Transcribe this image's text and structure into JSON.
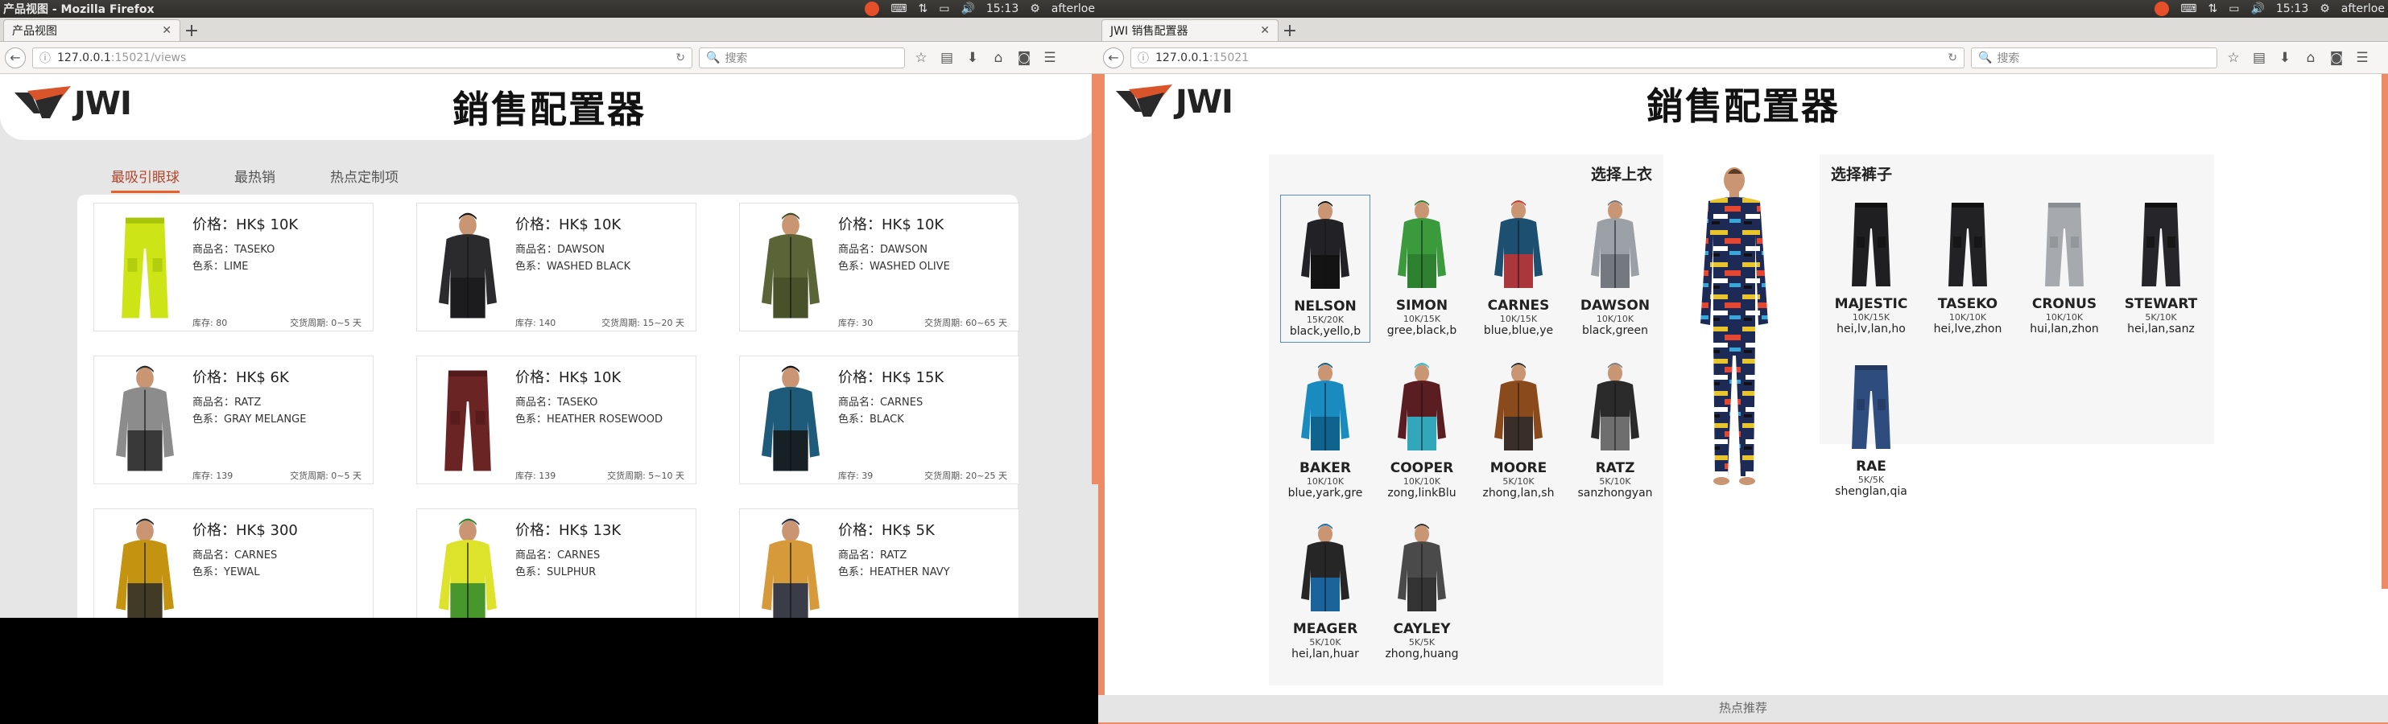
{
  "left": {
    "window_title": "产品视图 - Mozilla Firefox",
    "tab_title": "产品视图",
    "url_host": "127.0.0.1",
    "url_rest": ":15021/views",
    "search_placeholder": "搜索",
    "indicators": {
      "time": "15:13",
      "user": "afterloe"
    },
    "logo": "JWI",
    "title": "銷售配置器",
    "tabs": [
      "最吸引眼球",
      "最热销",
      "热点定制项"
    ],
    "cards": [
      {
        "price": "价格：HK$ 10K",
        "name": "商品名：TASEKO",
        "color": "色系：LIME",
        "stock": "库存: 80",
        "lead": "交货周期: 0~5 天",
        "img": "pants",
        "c1": "#cde516",
        "c2": "#a8c40b"
      },
      {
        "price": "价格：HK$ 10K",
        "name": "商品名：DAWSON",
        "color": "色系：WASHED BLACK",
        "stock": "库存: 140",
        "lead": "交货周期: 15~20 天",
        "img": "jacket",
        "c1": "#2b2b2e",
        "c2": "#1a1a1c"
      },
      {
        "price": "价格：HK$ 10K",
        "name": "商品名：DAWSON",
        "color": "色系：WASHED OLIVE",
        "stock": "库存: 30",
        "lead": "交货周期: 60~65 天",
        "img": "jacket",
        "c1": "#5a6436",
        "c2": "#454d28"
      },
      {
        "price": "价格：HK$ 6K",
        "name": "商品名：RATZ",
        "color": "色系：GRAY MELANGE",
        "stock": "库存: 139",
        "lead": "交货周期: 0~5 天",
        "img": "jacket",
        "c1": "#8c8c8c",
        "c2": "#2a2a2a"
      },
      {
        "price": "价格：HK$ 10K",
        "name": "商品名：TASEKO",
        "color": "色系：HEATHER ROSEWOOD",
        "stock": "库存: 139",
        "lead": "交货周期: 5~10 天",
        "img": "pants",
        "c1": "#6a2424",
        "c2": "#521a1a"
      },
      {
        "price": "价格：HK$ 15K",
        "name": "商品名：CARNES",
        "color": "色系：BLACK",
        "stock": "库存: 39",
        "lead": "交货周期: 20~25 天",
        "img": "jacket",
        "c1": "#1e5b7a",
        "c2": "#161616"
      },
      {
        "price": "价格：HK$ 300",
        "name": "商品名：CARNES",
        "color": "色系：YEWAL",
        "stock": "",
        "lead": "",
        "img": "jacket",
        "c1": "#c4930f",
        "c2": "#2a2a2a"
      },
      {
        "price": "价格：HK$ 13K",
        "name": "商品名：CARNES",
        "color": "色系：SULPHUR",
        "stock": "",
        "lead": "",
        "img": "jacket",
        "c1": "#dde22a",
        "c2": "#2d8a2e"
      },
      {
        "price": "价格：HK$ 5K",
        "name": "商品名：RATZ",
        "color": "色系：HEATHER NAVY",
        "stock": "",
        "lead": "",
        "img": "jacket",
        "c1": "#d69a3a",
        "c2": "#1f2b4a"
      }
    ]
  },
  "right": {
    "window_title": "",
    "tab_title": "JWI 销售配置器",
    "url_host": "127.0.0.1",
    "url_rest": ":15021",
    "search_placeholder": "搜索",
    "indicators": {
      "time": "15:13",
      "user": "afterloe"
    },
    "logo": "JWI",
    "title": "銷售配置器",
    "top_label": "选择上衣",
    "bottom_label": "选择裤子",
    "footer": "热点推荐",
    "tops": [
      {
        "name": "NELSON",
        "price": "15K/20K",
        "color": "black,yello,b",
        "c1": "#222226",
        "c2": "#111"
      },
      {
        "name": "SIMON",
        "price": "10K/15K",
        "color": "gree,black,b",
        "c1": "#3a9a3c",
        "c2": "#2c7d2e"
      },
      {
        "name": "CARNES",
        "price": "10K/15K",
        "color": "blue,blue,ye",
        "c1": "#1c4f70",
        "c2": "#c43232"
      },
      {
        "name": "DAWSON",
        "price": "10K/10K",
        "color": "black,green",
        "c1": "#9aa0a6",
        "c2": "#6d7278"
      },
      {
        "name": "BAKER",
        "price": "10K/10K",
        "color": "blue,yark,gre",
        "c1": "#1a8bbf",
        "c2": "#0d5d86"
      },
      {
        "name": "COOPER",
        "price": "10K/10K",
        "color": "zong,linkBlu",
        "c1": "#5a1d22",
        "c2": "#2cc0d6"
      },
      {
        "name": "MOORE",
        "price": "5K/10K",
        "color": "zhong,lan,sh",
        "c1": "#8a4a1c",
        "c2": "#2a2a2a"
      },
      {
        "name": "RATZ",
        "price": "5K/10K",
        "color": "sanzhongyan",
        "c1": "#2a2a2a",
        "c2": "#7a7a7a"
      },
      {
        "name": "MEAGER",
        "price": "5K/10K",
        "color": "hei,lan,huar",
        "c1": "#262626",
        "c2": "#1a6fb0"
      },
      {
        "name": "CAYLEY",
        "price": "5K/5K",
        "color": "zhong,huang",
        "c1": "#4a4a4a",
        "c2": "#2f2f2f"
      }
    ],
    "bottoms": [
      {
        "name": "MAJESTIC",
        "price": "10K/15K",
        "color": "hei,lv,lan,ho",
        "c1": "#1f1f22",
        "c2": "#111"
      },
      {
        "name": "TASEKO",
        "price": "10K/10K",
        "color": "hei,lve,zhon",
        "c1": "#222225",
        "c2": "#111"
      },
      {
        "name": "CRONUS",
        "price": "10K/10K",
        "color": "hui,lan,zhon",
        "c1": "#a6aaae",
        "c2": "#8a8e92"
      },
      {
        "name": "STEWART",
        "price": "5K/10K",
        "color": "hei,lan,sanz",
        "c1": "#26262a",
        "c2": "#111"
      },
      {
        "name": "RAE",
        "price": "5K/5K",
        "color": "shenglan,qia",
        "c1": "#2f4c7e",
        "c2": "#22385f"
      }
    ]
  }
}
